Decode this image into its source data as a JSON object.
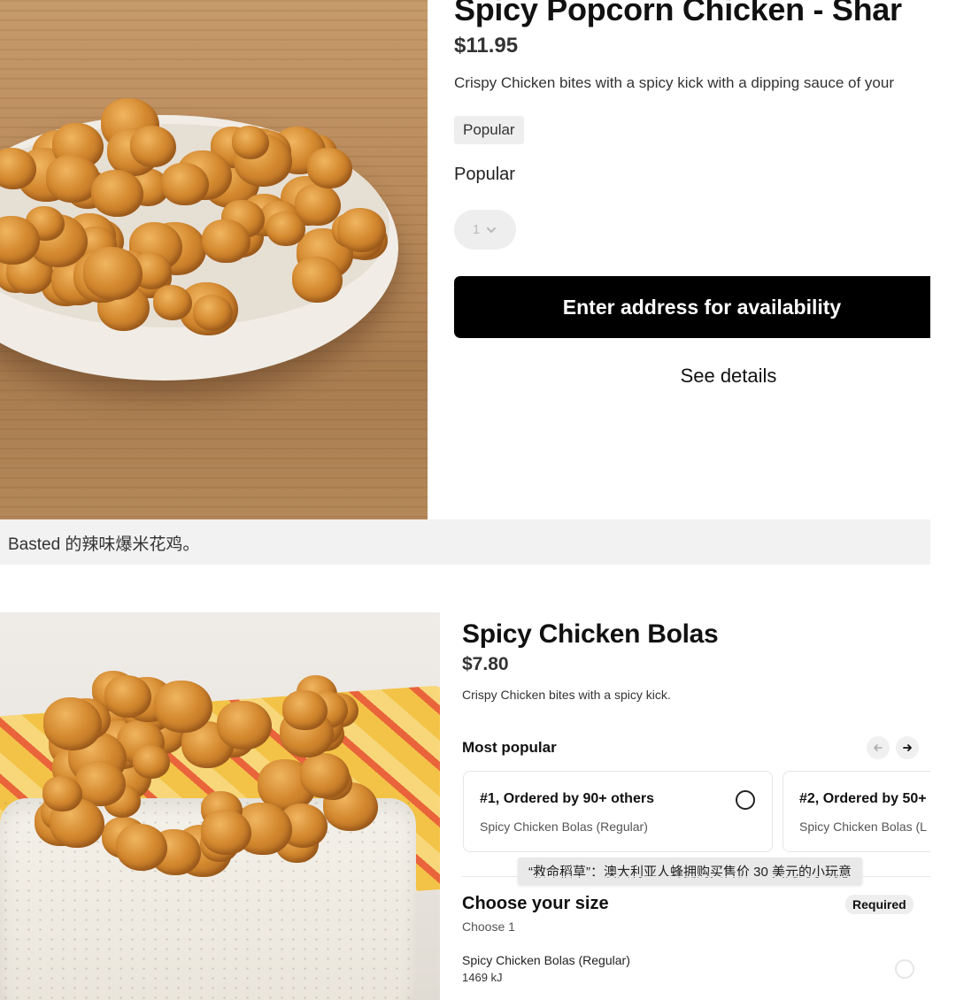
{
  "product_top": {
    "title": "Spicy Popcorn Chicken - Shar",
    "price": "$11.95",
    "description": "Crispy Chicken bites with a spicy kick with a dipping sauce of your",
    "tag": "Popular",
    "section_label": "Popular",
    "quantity": "1",
    "cta_label": "Enter address for availability",
    "details_label": "See details",
    "image_alt": "bowl of popcorn chicken"
  },
  "caption": "Basted 的辣味爆米花鸡。",
  "product_bottom": {
    "title": "Spicy Chicken Bolas",
    "price": "$7.80",
    "description": "Crispy Chicken bites with a spicy kick.",
    "most_popular_title": "Most popular",
    "cards": [
      {
        "title": "#1, Ordered by 90+ others",
        "subtitle": "Spicy Chicken Bolas (Regular)"
      },
      {
        "title": "#2, Ordered by 50+",
        "subtitle": "Spicy Chicken Bolas (L"
      }
    ],
    "tooltip": "“救命稻草”：澳大利亚人蜂拥购买售价 30 美元的小玩意",
    "size_title": "Choose your size",
    "required_badge": "Required",
    "choose_hint": "Choose 1",
    "option": {
      "name": "Spicy Chicken Bolas (Regular)",
      "energy": "1469 kJ"
    }
  },
  "icons": [
    "chevron-down-icon",
    "arrow-left-icon",
    "arrow-right-icon",
    "radio-icon"
  ],
  "colors": {
    "cta_bg": "#000000",
    "chip_bg": "#eeeeee",
    "caption_bg": "#f2f2f2"
  }
}
